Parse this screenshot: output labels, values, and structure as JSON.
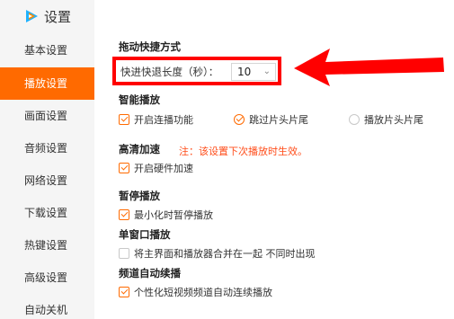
{
  "app": {
    "title": "设置",
    "logo_icon": "tencent-video-play-icon",
    "accent": "#ff6a00",
    "highlight": "#ff0000"
  },
  "sidebar": {
    "items": [
      {
        "label": "基本设置",
        "active": false
      },
      {
        "label": "播放设置",
        "active": true
      },
      {
        "label": "画面设置",
        "active": false
      },
      {
        "label": "音频设置",
        "active": false
      },
      {
        "label": "网络设置",
        "active": false
      },
      {
        "label": "下载设置",
        "active": false
      },
      {
        "label": "热键设置",
        "active": false
      },
      {
        "label": "高级设置",
        "active": false
      },
      {
        "label": "自动关机",
        "active": false
      }
    ]
  },
  "main": {
    "drag_shortcut": {
      "title": "拖动快捷方式",
      "speed_label": "快进快退长度（秒）：",
      "speed_value": "10"
    },
    "smart_play": {
      "title": "智能播放",
      "continuous": {
        "label": "开启连播功能",
        "checked": true
      },
      "skip_intro": {
        "label": "跳过片头片尾",
        "checked": true
      },
      "play_intro": {
        "label": "播放片头片尾",
        "checked": false
      }
    },
    "hd_accel": {
      "title": "高清加速",
      "note": "注：该设置下次播放时生效。",
      "hardware": {
        "label": "开启硬件加速",
        "checked": true
      }
    },
    "pause_play": {
      "title": "暂停播放",
      "minimize_pause": {
        "label": "最小化时暂停播放",
        "checked": true
      }
    },
    "single_window": {
      "title": "单窗口播放",
      "merge": {
        "label": "将主界面和播放器合并在一起 不同时出现",
        "checked": false
      }
    },
    "channel_autoplay": {
      "title": "频道自动续播",
      "short_video": {
        "label": "个性化短视频频道自动连续播放",
        "checked": true
      }
    }
  }
}
